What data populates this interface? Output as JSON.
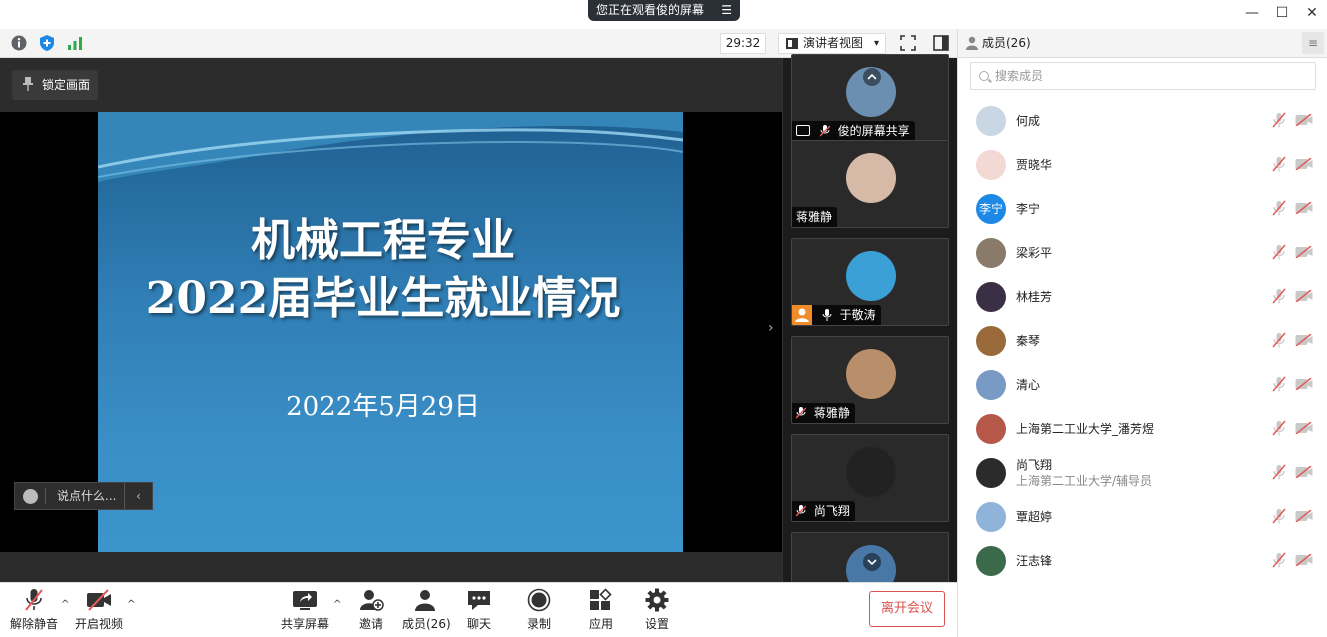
{
  "titlebar": {
    "share_notice": "您正在观看俊的屏幕",
    "share_menu_glyph": "☰",
    "minimize_glyph": "—",
    "maximize_glyph": "☐",
    "close_glyph": "✕"
  },
  "toolbar": {
    "timer": "29:32",
    "view_mode": "演讲者视图",
    "view_caret": "▾"
  },
  "stage": {
    "pin_label": "锁定画面",
    "slide_title_line1": "机械工程专业",
    "slide_title_line2": "2022届毕业生就业情况",
    "slide_date": "2022年5月29日",
    "chat_placeholder": "说点什么...",
    "chat_collapse": "‹",
    "expand_arrow": "›"
  },
  "strip": {
    "nav_up": "^",
    "nav_down": "v",
    "tiles": [
      {
        "label": "俊的屏幕共享",
        "avatar_color": "#6a8fb0"
      },
      {
        "label": "蒋雅静",
        "avatar_color": "#d7b9a8"
      },
      {
        "label": "于敬涛",
        "avatar_color": "#3aa0d6"
      },
      {
        "label": "蒋雅静",
        "avatar_color": "#b88e6b"
      },
      {
        "label": "尚飞翔",
        "avatar_color": "#222222"
      },
      {
        "label": "",
        "avatar_color": "#4a78a6"
      }
    ]
  },
  "members": {
    "header": "成员(26)",
    "menu_glyph": "≡",
    "search_placeholder": "搜索成员",
    "list": [
      {
        "name": "何成",
        "sub": "",
        "avatar_text": "",
        "avatar_color": "#c9d6e4"
      },
      {
        "name": "贾晓华",
        "sub": "",
        "avatar_text": "",
        "avatar_color": "#f2d9d3"
      },
      {
        "name": "李宁",
        "sub": "",
        "avatar_text": "李宁",
        "avatar_color": "#1e88e5"
      },
      {
        "name": "梁彩平",
        "sub": "",
        "avatar_text": "",
        "avatar_color": "#8a7a6a"
      },
      {
        "name": "林桂芳",
        "sub": "",
        "avatar_text": "",
        "avatar_color": "#3a2f45"
      },
      {
        "name": "秦琴",
        "sub": "",
        "avatar_text": "",
        "avatar_color": "#9a6a3a"
      },
      {
        "name": "清心",
        "sub": "",
        "avatar_text": "",
        "avatar_color": "#7a9ac6"
      },
      {
        "name": "上海第二工业大学_潘芳煜",
        "sub": "",
        "avatar_text": "",
        "avatar_color": "#b5584a"
      },
      {
        "name": "尚飞翔",
        "sub": "上海第二工业大学/辅导员",
        "avatar_text": "",
        "avatar_color": "#2b2b2b"
      },
      {
        "name": "覃超婷",
        "sub": "",
        "avatar_text": "",
        "avatar_color": "#8fb3d9"
      },
      {
        "name": "汪志锋",
        "sub": "",
        "avatar_text": "",
        "avatar_color": "#3a6a4a"
      }
    ]
  },
  "bottombar": {
    "unmute": "解除静音",
    "start_video": "开启视频",
    "share_screen": "共享屏幕",
    "invite": "邀请",
    "members": "成员(26)",
    "chat": "聊天",
    "record": "录制",
    "apps": "应用",
    "settings": "设置",
    "leave": "离开会议",
    "caret": "^"
  },
  "colors": {
    "accent": "#1e88e5",
    "leave": "#d9534f",
    "host_badge": "#f08c2a",
    "muted_red": "#e35a5a"
  }
}
